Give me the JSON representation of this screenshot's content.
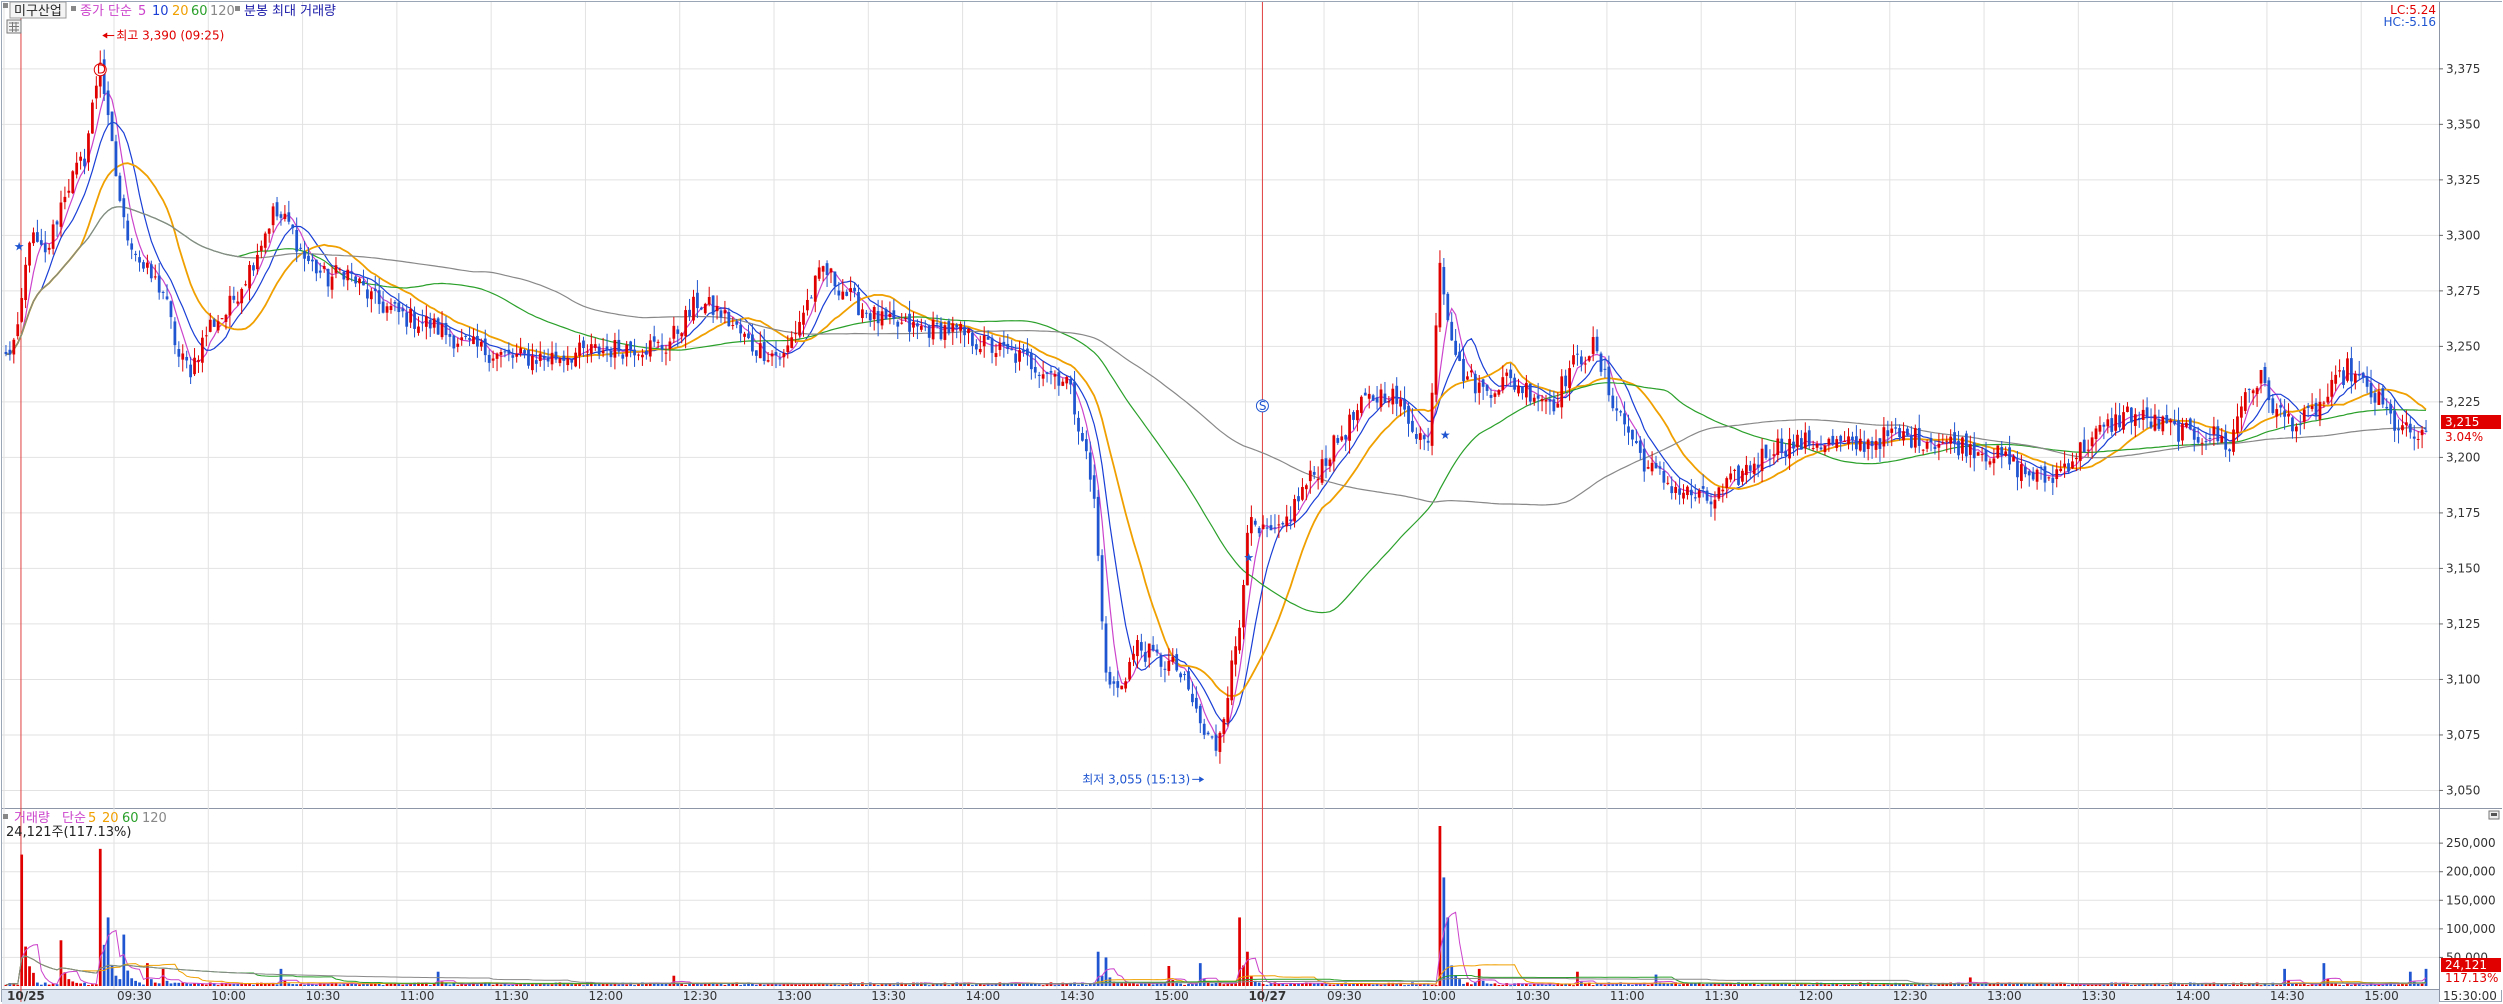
{
  "chart_data": [
    {
      "type": "candlestick",
      "panel": "price",
      "legend": {
        "symbol": "미구산업",
        "ma_label": "종가 단순",
        "periods": [
          "5",
          "10",
          "20",
          "60",
          "120"
        ],
        "extra": "분봉 최대 거래량"
      },
      "corner": {
        "lc": "LC:5.24",
        "hc": "HC:-5.16"
      },
      "y_ticks": [
        "3,375",
        "3,350",
        "3,325",
        "3,300",
        "3,275",
        "3,250",
        "3,225",
        "3,200",
        "3,175",
        "3,150",
        "3,125",
        "3,100",
        "3,075",
        "3,050"
      ],
      "y_tick_values": [
        3375,
        3350,
        3325,
        3300,
        3275,
        3250,
        3225,
        3200,
        3175,
        3150,
        3125,
        3100,
        3075,
        3050
      ],
      "ylim": [
        3043,
        3397
      ],
      "current_price": {
        "value": 3215,
        "label": "3,215",
        "pct": "3.04%"
      },
      "high_label": "최고 3,390 (09:25)",
      "low_label": "최저 3,055 (15:13)",
      "marker_d": "D",
      "marker_s": "S",
      "ohlc_keypoints": [
        [
          0,
          3245
        ],
        [
          3,
          3255
        ],
        [
          6,
          3300
        ],
        [
          10,
          3290
        ],
        [
          15,
          3320
        ],
        [
          20,
          3335
        ],
        [
          24,
          3380
        ],
        [
          26,
          3350
        ],
        [
          30,
          3305
        ],
        [
          35,
          3285
        ],
        [
          40,
          3275
        ],
        [
          44,
          3245
        ],
        [
          47,
          3240
        ],
        [
          52,
          3260
        ],
        [
          56,
          3265
        ],
        [
          62,
          3285
        ],
        [
          68,
          3310
        ],
        [
          72,
          3305
        ],
        [
          76,
          3290
        ],
        [
          82,
          3280
        ],
        [
          86,
          3285
        ],
        [
          94,
          3270
        ],
        [
          102,
          3263
        ],
        [
          108,
          3260
        ],
        [
          118,
          3250
        ],
        [
          128,
          3245
        ],
        [
          138,
          3245
        ],
        [
          150,
          3248
        ],
        [
          160,
          3250
        ],
        [
          168,
          3250
        ],
        [
          176,
          3270
        ],
        [
          182,
          3265
        ],
        [
          190,
          3250
        ],
        [
          198,
          3245
        ],
        [
          204,
          3270
        ],
        [
          208,
          3285
        ],
        [
          216,
          3270
        ],
        [
          224,
          3260
        ],
        [
          232,
          3258
        ],
        [
          240,
          3258
        ],
        [
          250,
          3250
        ],
        [
          258,
          3245
        ],
        [
          264,
          3240
        ],
        [
          270,
          3235
        ],
        [
          274,
          3210
        ],
        [
          277,
          3180
        ],
        [
          279,
          3130
        ],
        [
          280,
          3100
        ],
        [
          283,
          3095
        ],
        [
          288,
          3115
        ],
        [
          292,
          3110
        ],
        [
          298,
          3105
        ],
        [
          302,
          3090
        ],
        [
          305,
          3075
        ],
        [
          308,
          3070
        ],
        [
          311,
          3095
        ],
        [
          314,
          3125
        ],
        [
          316,
          3170
        ],
        [
          319,
          3165
        ],
        [
          324,
          3165
        ],
        [
          330,
          3185
        ],
        [
          336,
          3200
        ],
        [
          340,
          3210
        ],
        [
          346,
          3225
        ],
        [
          352,
          3230
        ],
        [
          358,
          3215
        ],
        [
          362,
          3205
        ],
        [
          365,
          3290
        ],
        [
          367,
          3265
        ],
        [
          370,
          3240
        ],
        [
          376,
          3230
        ],
        [
          382,
          3235
        ],
        [
          388,
          3230
        ],
        [
          394,
          3225
        ],
        [
          398,
          3240
        ],
        [
          404,
          3250
        ],
        [
          408,
          3230
        ],
        [
          412,
          3215
        ],
        [
          418,
          3195
        ],
        [
          426,
          3185
        ],
        [
          434,
          3180
        ],
        [
          442,
          3193
        ],
        [
          450,
          3205
        ],
        [
          460,
          3207
        ],
        [
          470,
          3205
        ],
        [
          480,
          3210
        ],
        [
          490,
          3208
        ],
        [
          500,
          3205
        ],
        [
          508,
          3200
        ],
        [
          514,
          3193
        ],
        [
          520,
          3190
        ],
        [
          526,
          3200
        ],
        [
          532,
          3210
        ],
        [
          540,
          3220
        ],
        [
          548,
          3215
        ],
        [
          556,
          3210
        ],
        [
          562,
          3210
        ],
        [
          566,
          3205
        ],
        [
          570,
          3230
        ],
        [
          574,
          3235
        ],
        [
          578,
          3220
        ],
        [
          584,
          3215
        ],
        [
          590,
          3225
        ],
        [
          596,
          3240
        ],
        [
          600,
          3232
        ],
        [
          604,
          3225
        ],
        [
          608,
          3215
        ],
        [
          612,
          3210
        ],
        [
          616,
          3208
        ]
      ],
      "ma_colors": {
        "5": "#cc44cc",
        "10": "#1a3fd6",
        "20": "#f0a000",
        "60": "#2aa02a",
        "120": "#888888"
      }
    },
    {
      "type": "bar",
      "panel": "volume",
      "legend": {
        "label": "거래량",
        "ma_label": "단순",
        "periods": [
          "5",
          "20",
          "60",
          "120"
        ]
      },
      "info": "24,121주(117.13%)",
      "y_ticks": [
        "250,000",
        "200,000",
        "150,000",
        "100,000",
        "50,000"
      ],
      "y_tick_values": [
        250000,
        200000,
        150000,
        100000,
        50000
      ],
      "ylim": [
        0,
        280000
      ],
      "current_volume": {
        "value": 24121,
        "label": "24,121",
        "pct": "117.13%"
      },
      "spikes": [
        [
          4,
          230000
        ],
        [
          14,
          80000
        ],
        [
          24,
          240000
        ],
        [
          26,
          120000
        ],
        [
          30,
          90000
        ],
        [
          36,
          40000
        ],
        [
          40,
          30000
        ],
        [
          70,
          30000
        ],
        [
          110,
          25000
        ],
        [
          170,
          18000
        ],
        [
          278,
          60000
        ],
        [
          280,
          50000
        ],
        [
          296,
          35000
        ],
        [
          304,
          40000
        ],
        [
          314,
          120000
        ],
        [
          316,
          60000
        ],
        [
          365,
          280000
        ],
        [
          366,
          190000
        ],
        [
          367,
          120000
        ],
        [
          375,
          30000
        ],
        [
          400,
          25000
        ],
        [
          420,
          20000
        ],
        [
          500,
          15000
        ],
        [
          580,
          30000
        ],
        [
          590,
          40000
        ],
        [
          612,
          25000
        ],
        [
          616,
          30000
        ]
      ]
    }
  ],
  "x_axis": {
    "tick_indices": [
      0,
      28,
      52,
      76,
      100,
      124,
      148,
      172,
      196,
      220,
      244,
      268,
      292,
      316,
      336,
      360,
      384,
      408,
      432,
      456,
      480,
      504,
      528,
      552,
      576,
      600
    ],
    "labels": [
      "10/25",
      "09:30",
      "10:00",
      "10:30",
      "11:00",
      "11:30",
      "12:00",
      "12:30",
      "13:00",
      "13:30",
      "14:00",
      "14:30",
      "15:00",
      "10/27",
      "09:30",
      "10:00",
      "10:30",
      "11:00",
      "11:30",
      "12:00",
      "12:30",
      "13:00",
      "13:30",
      "14:00",
      "14:30",
      "15:00"
    ],
    "end_label": "15:30:00",
    "n_bars": 617
  },
  "colors": {
    "up": "#e00000",
    "down": "#1f55d0",
    "grid": "#e2e2e2",
    "axis_bg": "#dfe7f3",
    "day_line": "#e04040",
    "price_tag": "#e00000"
  },
  "icons": {
    "menu": "grid-menu-icon",
    "scroll": "scroll-marker-icon"
  }
}
